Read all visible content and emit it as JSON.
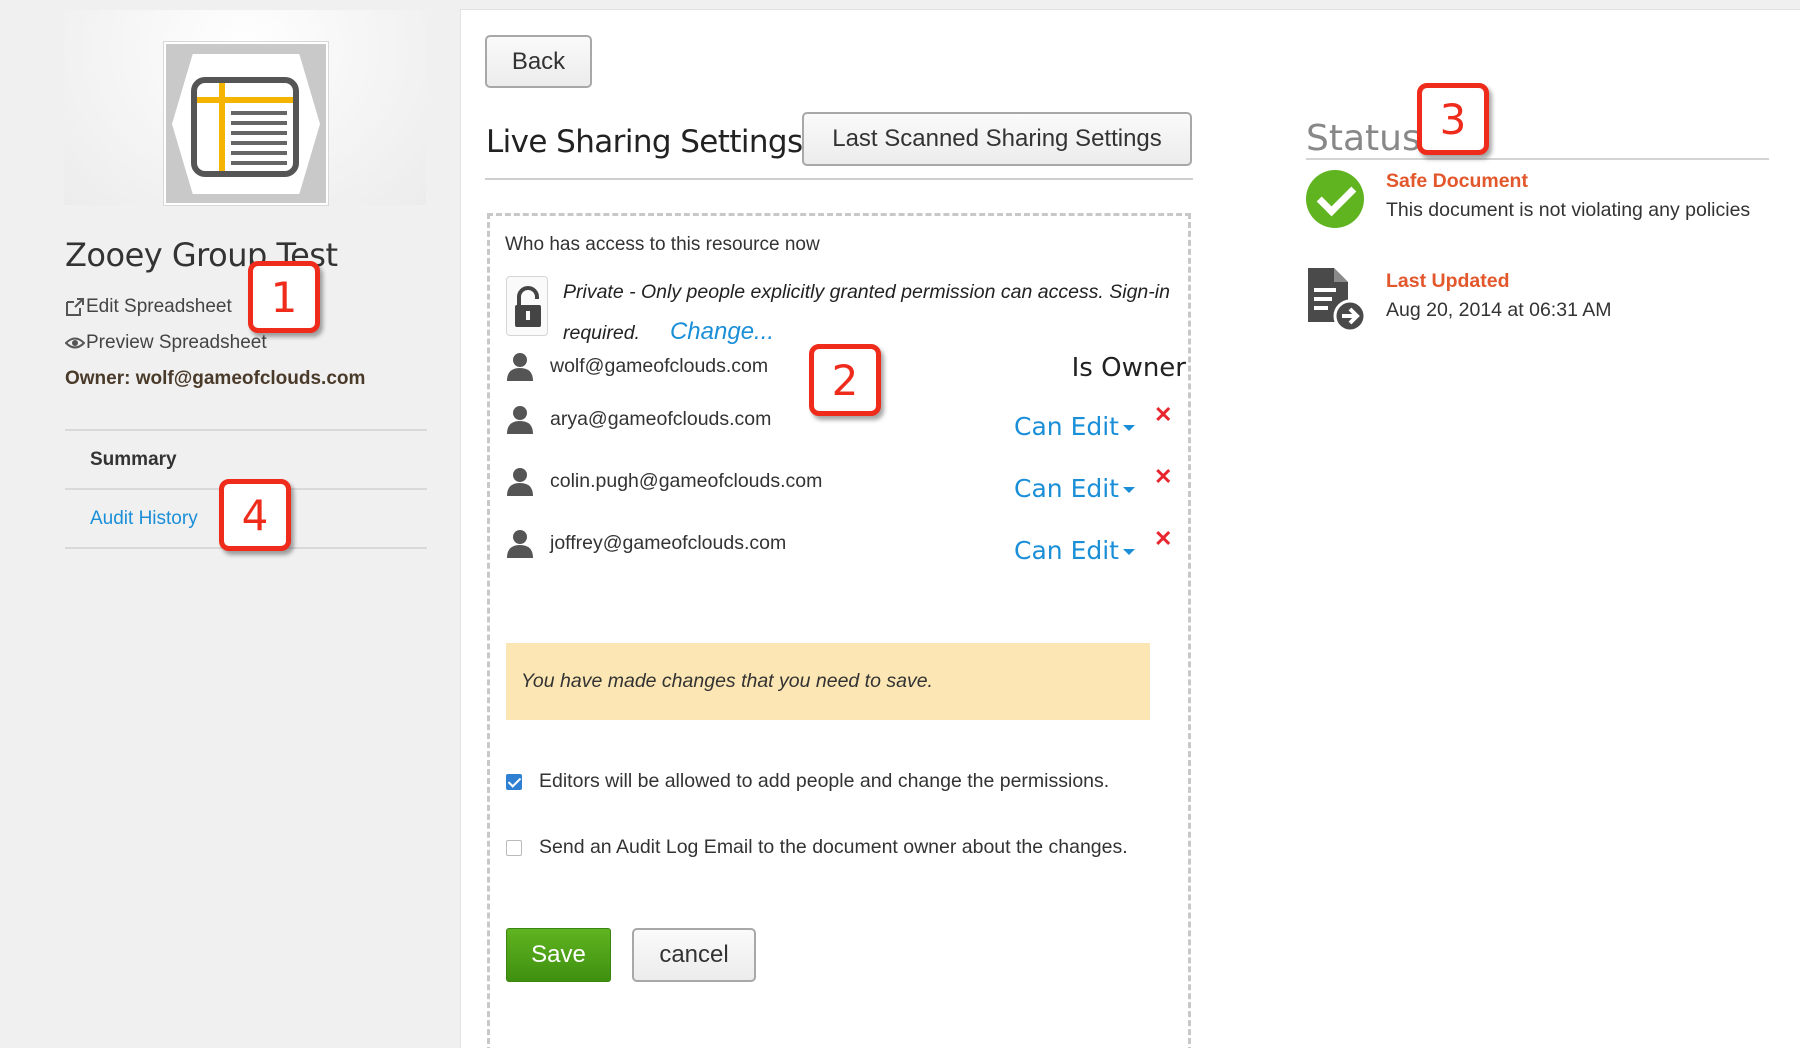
{
  "sidebar": {
    "doc_title": "Zooey Group Test",
    "edit_link": "Edit Spreadsheet",
    "preview_link": "Preview Spreadsheet",
    "owner": "Owner: wolf@gameofclouds.com",
    "nav": [
      {
        "label": "Summary"
      },
      {
        "label": "Audit History"
      }
    ]
  },
  "main": {
    "back_label": "Back",
    "live_title": "Live Sharing Settings",
    "scanned_label": "Last Scanned Sharing Settings",
    "who_label": "Who has access to this resource now",
    "privacy_text": "Private - Only people explicitly granted permission can access. Sign-in required.",
    "change_link": "Change...",
    "people": [
      {
        "email": "wolf@gameofclouds.com",
        "role": "Is Owner"
      },
      {
        "email": "arya@gameofclouds.com",
        "permission": "Can Edit",
        "remove": "✕"
      },
      {
        "email": "colin.pugh@gameofclouds.com",
        "permission": "Can Edit",
        "remove": "✕"
      },
      {
        "email": "joffrey@gameofclouds.com",
        "permission": "Can Edit",
        "remove": "✕"
      }
    ],
    "warning": "You have made changes that you need to save.",
    "option_editors": "Editors will be allowed to add people and change the permissions.",
    "option_editors_checked": true,
    "option_audit": "Send an Audit Log Email to the document owner about the changes.",
    "option_audit_checked": false,
    "save_label": "Save",
    "cancel_label": "cancel"
  },
  "status": {
    "title": "Status",
    "safe_label": "Safe Document",
    "safe_desc": "This document is not violating any policies",
    "updated_label": "Last Updated",
    "updated_date": "Aug 20, 2014 at 06:31 AM"
  },
  "callouts": [
    "1",
    "2",
    "3",
    "4"
  ],
  "colors": {
    "link_blue": "#1a8fd8",
    "status_orange": "#e2572b",
    "save_green": "#5fb420",
    "callout_red": "#ef2c1b",
    "warning_bg": "#fbe6b4"
  }
}
